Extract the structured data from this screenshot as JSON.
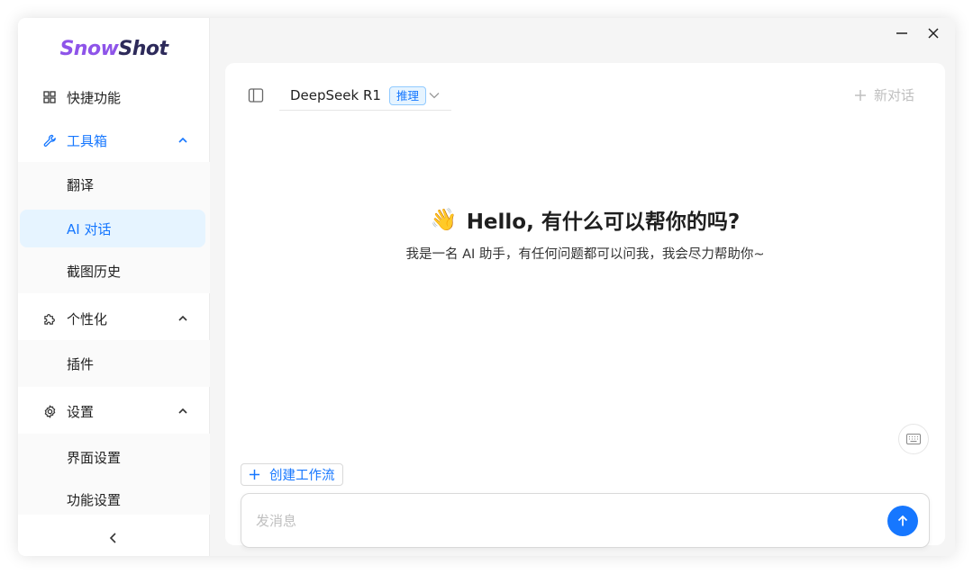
{
  "brand": {
    "part1": "Snow",
    "part2": "Shot"
  },
  "sidebar": {
    "quick": {
      "label": "快捷功能",
      "icon": "grid-icon"
    },
    "tools": {
      "label": "工具箱",
      "icon": "wrench-icon",
      "items": [
        {
          "label": "翻译"
        },
        {
          "label": "AI 对话"
        },
        {
          "label": "截图历史"
        }
      ]
    },
    "personalize": {
      "label": "个性化",
      "icon": "puzzle-icon",
      "items": [
        {
          "label": "插件"
        }
      ]
    },
    "settings": {
      "label": "设置",
      "icon": "gear-icon",
      "items": [
        {
          "label": "界面设置"
        },
        {
          "label": "功能设置"
        }
      ]
    }
  },
  "chat": {
    "model_name": "DeepSeek R1",
    "model_tag": "推理",
    "new_chat_label": "新对话",
    "greeting": "Hello, 有什么可以帮你的吗?",
    "greeting_emoji": "👋",
    "subtitle": "我是一名 AI 助手，有任何问题都可以问我，我会尽力帮助你~",
    "workflow_label": "创建工作流",
    "input_placeholder": "发消息",
    "input_value": ""
  },
  "colors": {
    "accent": "#1677ff",
    "selected_bg": "#e6f4ff",
    "brand_purple": "#8e54e9"
  }
}
